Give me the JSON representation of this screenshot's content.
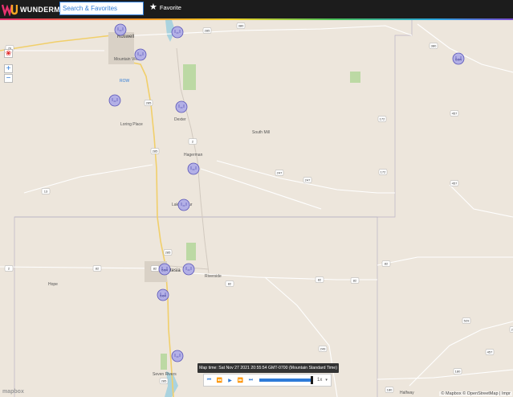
{
  "header": {
    "logo_text": "WUNDERMAP",
    "search_placeholder": "Search & Favorites",
    "favorite_label": "Favorite"
  },
  "colors": {
    "topbar": "#1c1c1c",
    "accent": "#2d7bd8",
    "station_fill": "#b3b0e6",
    "station_stroke": "#5a55b8",
    "land": "#ede6dc",
    "park": "#bcd9a4",
    "water": "#aad3df",
    "road_major": "#f1cf6a"
  },
  "map": {
    "places": [
      "Roswell",
      "Mountain View",
      "ROW",
      "Loring Place",
      "Dexter",
      "South Mill",
      "Hagerman",
      "Lake Arthur",
      "Artesia",
      "Hope",
      "Riverside",
      "Seven Rivers",
      "Halfway"
    ],
    "route_shields": [
      "285",
      "380",
      "70",
      "285",
      "2",
      "285",
      "247",
      "247",
      "13",
      "2",
      "285",
      "82",
      "82",
      "82",
      "82",
      "82",
      "82",
      "285",
      "249",
      "380",
      "172",
      "172",
      "457",
      "457",
      "529",
      "457",
      "180",
      "180",
      "285"
    ],
    "stations": [
      "0.04",
      "0.04",
      "0.04"
    ]
  },
  "controls": {
    "zoom_in": "+",
    "zoom_out": "−",
    "layers_icon": "❀"
  },
  "timebar": {
    "map_time": "Map time: Sat Nov 27 2021 20:55:54 GMT-0700 (Mountain Standard Time)",
    "speed": "1x",
    "progress": 1.0
  },
  "attribution": "© Mapbox © OpenStreetMap | Impr",
  "mapbox_logo": "mapbox"
}
